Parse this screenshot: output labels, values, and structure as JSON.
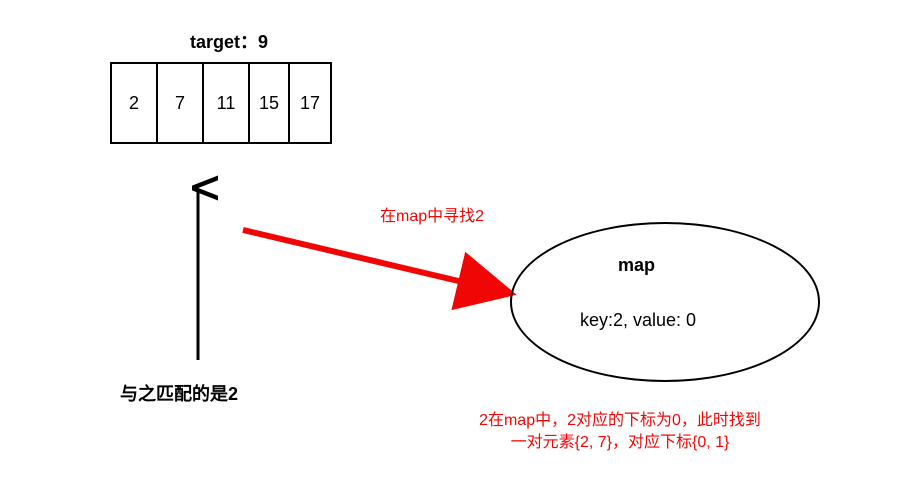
{
  "target_label": "target：9",
  "array": [
    "2",
    "7",
    "11",
    "15",
    "17"
  ],
  "match_label": "与之匹配的是2",
  "annotation": "在map中寻找2",
  "map": {
    "title": "map",
    "kv": "key:2, value: 0"
  },
  "explain_line1": "2在map中，2对应的下标为0，此时找到",
  "explain_line2": "一对元素{2, 7}，对应下标{0, 1}",
  "colors": {
    "red": "#f10606",
    "black": "#000000"
  },
  "chart_data": {
    "type": "table",
    "title": "Two Sum hashmap lookup step",
    "target": 9,
    "array_values": [
      2,
      7,
      11,
      15,
      17
    ],
    "current_index": 1,
    "current_value": 7,
    "complement": 2,
    "map_entries": [
      {
        "key": 2,
        "value": 0
      }
    ],
    "found_pair_values": [
      2,
      7
    ],
    "found_pair_indices": [
      0,
      1
    ]
  }
}
